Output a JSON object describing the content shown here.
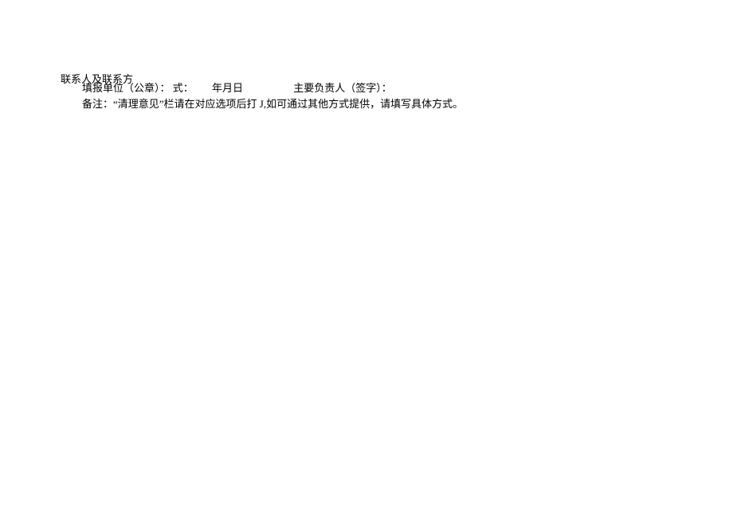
{
  "contact": {
    "label": "联系人及联系方"
  },
  "formLine": {
    "unitSeal": "填报单位（公章）：",
    "shi": "式：",
    "date": "年月日",
    "responsible": "主要负责人（签字）："
  },
  "note": {
    "text": "备注：“清理意见”栏请在对应选项后打 J,如可通过其他方式提供，请填写具体方式。"
  }
}
